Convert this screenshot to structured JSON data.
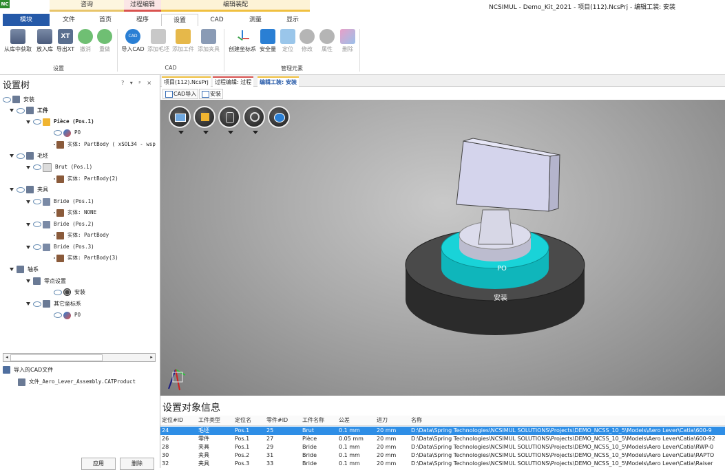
{
  "app": {
    "logo": "NC",
    "window_title": "NCSIMUL - Demo_Kit_2021 - 项目(112).NcsPrj - 编辑工装: 安装"
  },
  "context_groups": [
    {
      "label": "咨询",
      "color": "#e8c56a"
    },
    {
      "label": "过程编辑",
      "color": "#d9534f"
    },
    {
      "label": "编辑装配",
      "color": "#f0c040"
    }
  ],
  "tabs": [
    "模块",
    "文件",
    "首页",
    "程序",
    "设置",
    "CAD",
    "测量",
    "显示"
  ],
  "ribbon": {
    "group1": {
      "label": "设置",
      "buttons": [
        "从库中获取",
        "放入库",
        "导出XT",
        "撤消",
        "重做"
      ]
    },
    "group2": {
      "label": "CAD",
      "buttons": [
        "导入CAD",
        "添加毛坯",
        "添加工件",
        "添加夹具"
      ]
    },
    "group3": {
      "label": "管理元素",
      "buttons": [
        "创建坐标系",
        "安全量",
        "定位",
        "修改",
        "属性",
        "删除"
      ]
    }
  },
  "tree": {
    "title": "设置树",
    "controls": "? ▾ ᵖ ×",
    "rows": [
      {
        "label": "安装",
        "bold": false
      },
      {
        "label": "工件",
        "bold": true
      },
      {
        "label": "Pièce  (Pos.1)",
        "bold": true
      },
      {
        "label": "PO",
        "bold": false
      },
      {
        "label": "实体: PartBody ( xSOL34 - wsp",
        "bold": false
      },
      {
        "label": "毛坯",
        "bold": false
      },
      {
        "label": "Brut  (Pos.1)",
        "bold": false
      },
      {
        "label": "实体: PartBody(2)",
        "bold": false
      },
      {
        "label": "夹具",
        "bold": false
      },
      {
        "label": "Bride  (Pos.1)",
        "bold": false
      },
      {
        "label": "实体: NONE",
        "bold": false
      },
      {
        "label": "Bride  (Pos.2)",
        "bold": false
      },
      {
        "label": "实体: PartBody",
        "bold": false
      },
      {
        "label": "Bride  (Pos.3)",
        "bold": false
      },
      {
        "label": "实体: PartBody(3)",
        "bold": false
      },
      {
        "label": "轴系",
        "bold": false
      },
      {
        "label": "零点设置",
        "bold": false
      },
      {
        "label": "安装",
        "bold": false
      },
      {
        "label": "其它坐标系",
        "bold": false
      },
      {
        "label": "PO",
        "bold": false
      }
    ]
  },
  "cad_import": {
    "title": "导入的CAD文件",
    "file": "文件_Aero_Lever_Assembly.CATProduct"
  },
  "panel_buttons": {
    "apply": "应用",
    "delete": "删除"
  },
  "doc_tabs": [
    "项目(112).NcsPrj",
    "过程编辑: 过程",
    "编辑工装: 安装"
  ],
  "view_tabs": [
    "CAD导入",
    "安装"
  ],
  "viewport": {
    "label_po": "PO",
    "label_setup": "安装"
  },
  "info": {
    "title": "设置对象信息",
    "columns": [
      "定位#ID",
      "工件类型",
      "定位名",
      "零件#ID",
      "工件名称",
      "公差",
      "进刀",
      "名称"
    ],
    "rows": [
      [
        "24",
        "毛坯",
        "Pos.1",
        "25",
        "Brut",
        "0.1 mm",
        "20 mm",
        "D:\\Data\\Spring Technologies\\NCSIMUL SOLUTIONS\\Projects\\DEMO_NCSS_10_5\\Models\\Aero Lever\\Catia\\600-9"
      ],
      [
        "26",
        "零件",
        "Pos.1",
        "27",
        "Pièce",
        "0.05 mm",
        "20 mm",
        "D:\\Data\\Spring Technologies\\NCSIMUL SOLUTIONS\\Projects\\DEMO_NCSS_10_5\\Models\\Aero Lever\\Catia\\600-92"
      ],
      [
        "28",
        "夹具",
        "Pos.1",
        "29",
        "Bride",
        "0.1 mm",
        "20 mm",
        "D:\\Data\\Spring Technologies\\NCSIMUL SOLUTIONS\\Projects\\DEMO_NCSS_10_5\\Models\\Aero Lever\\Catia\\RWP-0"
      ],
      [
        "30",
        "夹具",
        "Pos.2",
        "31",
        "Bride",
        "0.1 mm",
        "20 mm",
        "D:\\Data\\Spring Technologies\\NCSIMUL SOLUTIONS\\Projects\\DEMO_NCSS_10_5\\Models\\Aero Lever\\Catia\\RAPTO"
      ],
      [
        "32",
        "夹具",
        "Pos.3",
        "33",
        "Bride",
        "0.1 mm",
        "20 mm",
        "D:\\Data\\Spring Technologies\\NCSIMUL SOLUTIONS\\Projects\\DEMO_NCSS_10_5\\Models\\Aero Lever\\Catia\\Raiser"
      ]
    ],
    "selected_row": 0
  },
  "colors": {
    "file_tab": "#2559a8",
    "selection": "#2e8ee6",
    "fixture_cyan": "#19d3d8"
  }
}
